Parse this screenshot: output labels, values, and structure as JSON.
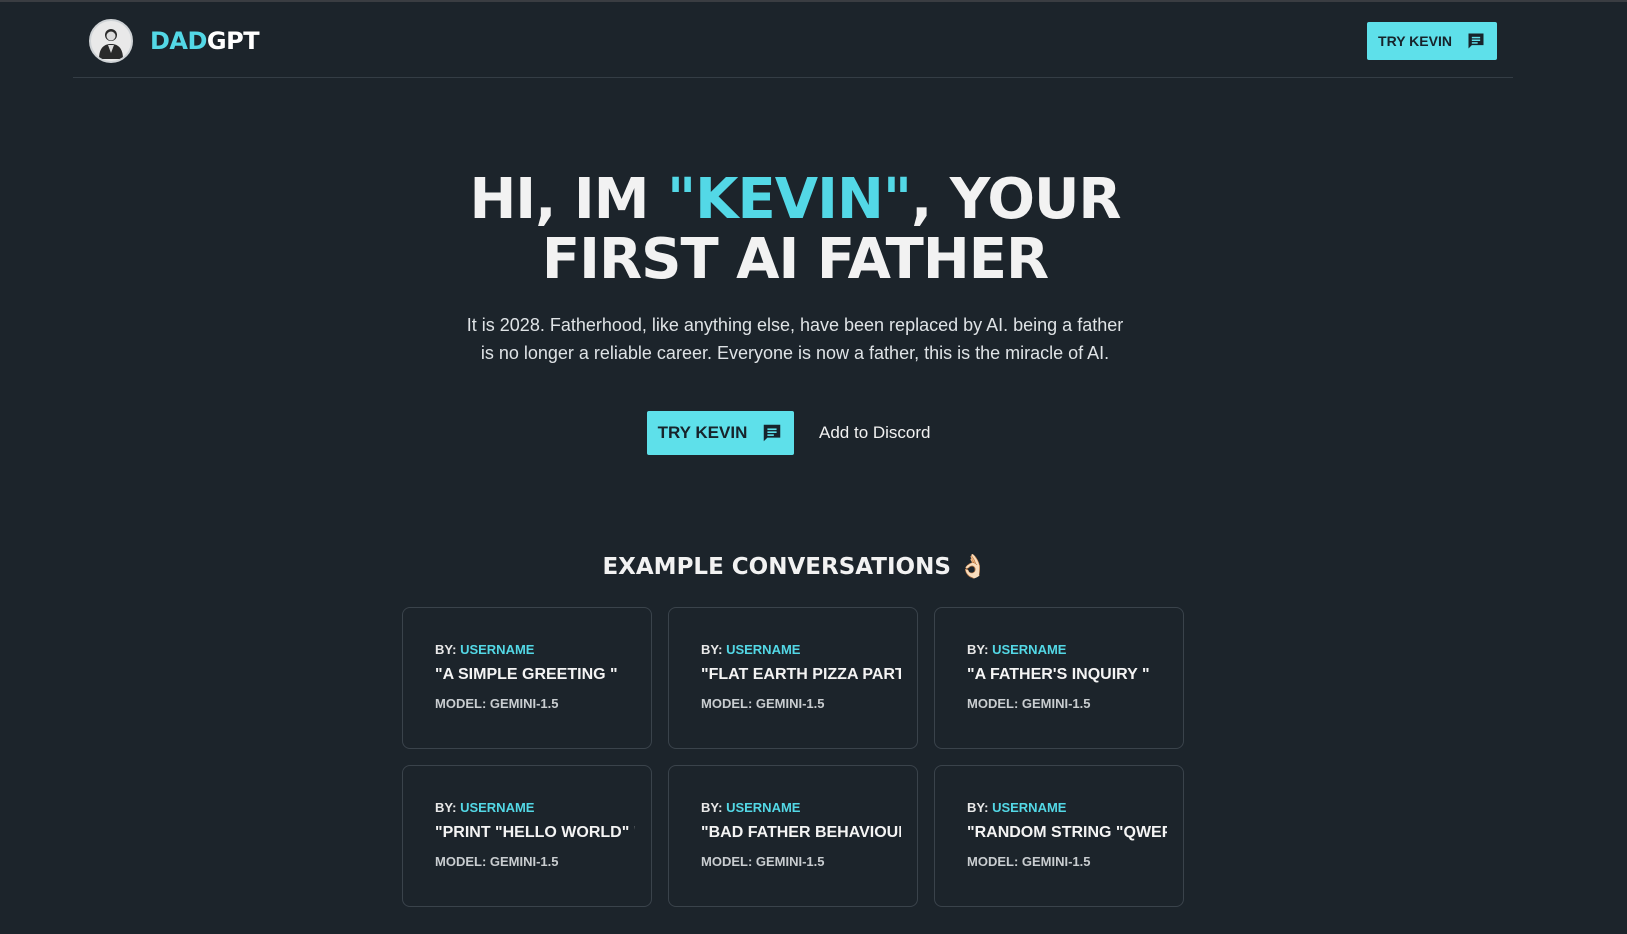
{
  "header": {
    "brand_accent": "DAD",
    "brand_rest": "GPT",
    "cta_label": "TRY KEVIN"
  },
  "hero": {
    "title_line1_pre": "HI, IM ",
    "title_name": "\"KEVIN\"",
    "title_line1_post": ", YOUR",
    "title_line2": "FIRST AI FATHER",
    "subtitle": "It is 2028. Fatherhood, like anything else, have been replaced by AI. being a father is no longer a reliable career. Everyone is now a father, this is the miracle of AI.",
    "cta_label": "TRY KEVIN",
    "discord_label": "Add to Discord"
  },
  "examples": {
    "title": "EXAMPLE CONVERSATIONS 👌🏻",
    "by_label": "BY:",
    "cards": [
      {
        "user": "USERNAME",
        "title": "\"A SIMPLE GREETING \"",
        "model": "MODEL: GEMINI-1.5"
      },
      {
        "user": "USERNAME",
        "title": "\"FLAT EARTH PIZZA PARTY\"",
        "model": "MODEL: GEMINI-1.5"
      },
      {
        "user": "USERNAME",
        "title": "\"A FATHER'S INQUIRY \"",
        "model": "MODEL: GEMINI-1.5"
      },
      {
        "user": "USERNAME",
        "title": "\"PRINT \"HELLO WORLD\" \"",
        "model": "MODEL: GEMINI-1.5"
      },
      {
        "user": "USERNAME",
        "title": "\"BAD FATHER BEHAVIOUR\"",
        "model": "MODEL: GEMINI-1.5"
      },
      {
        "user": "USERNAME",
        "title": "\"RANDOM STRING \"QWEPO\"",
        "model": "MODEL: GEMINI-1.5"
      }
    ]
  },
  "colors": {
    "background": "#1c242b",
    "accent": "#53d8e6",
    "button": "#5ee0ea"
  }
}
